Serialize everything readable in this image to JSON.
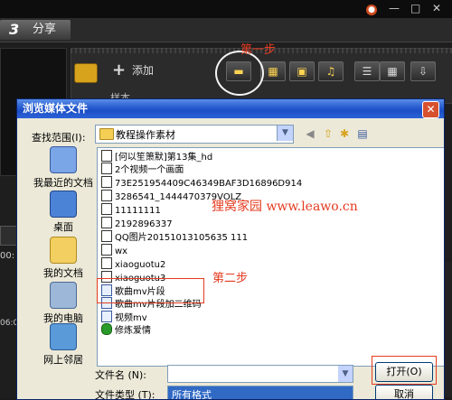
{
  "app": {
    "share_tab_number": "3",
    "share_tab_label": "分享",
    "add_label": "添加",
    "sub_label": "样本",
    "left_time_1": "00:",
    "left_time_2": "06:0",
    "top_icons": [
      "status-icon",
      "minimize-icon",
      "maximize-icon",
      "close-icon"
    ]
  },
  "annotations": {
    "step1": "第一步",
    "step2": "第二步",
    "watermark": "狸窝家园 www.leawo.cn"
  },
  "dialog": {
    "title": "浏览媒体文件",
    "close_glyph": "✕",
    "look_in_label": "查找范围(I):",
    "look_in_value": "教程操作素材",
    "places": [
      {
        "label": "我最近的文档",
        "icon": "recent-docs-icon"
      },
      {
        "label": "桌面",
        "icon": "desktop-icon"
      },
      {
        "label": "我的文档",
        "icon": "my-documents-icon"
      },
      {
        "label": "我的电脑",
        "icon": "my-computer-icon"
      },
      {
        "label": "网上邻居",
        "icon": "network-icon"
      }
    ],
    "files": [
      {
        "name": "[何以笙箫默]第13集_hd",
        "icon": "video"
      },
      {
        "name": "2个视频一个画面",
        "icon": "video"
      },
      {
        "name": "73E251954409C46349BAF3D16896D914",
        "icon": "video"
      },
      {
        "name": "3286541_1444470379VOLZ",
        "icon": "video"
      },
      {
        "name": "11111111",
        "icon": "video"
      },
      {
        "name": "2192896337",
        "icon": "video"
      },
      {
        "name": "QQ图片20151013105635 111",
        "icon": "video"
      },
      {
        "name": "wx",
        "icon": "video"
      },
      {
        "name": "xiaoguotu2",
        "icon": "video"
      },
      {
        "name": "xiaoguotu3",
        "icon": "video"
      },
      {
        "name": "歌曲mv片段",
        "icon": "video"
      },
      {
        "name": "歌曲mv片段加二维码",
        "icon": "video"
      },
      {
        "name": "视频mv",
        "icon": "video"
      },
      {
        "name": "修炼爱情",
        "icon": "audio"
      }
    ],
    "file_name_label": "文件名 (N):",
    "file_name_value": "",
    "file_type_label": "文件类型 (T):",
    "file_type_value": "所有格式",
    "open_label": "打开(O)",
    "cancel_label": "取消"
  }
}
